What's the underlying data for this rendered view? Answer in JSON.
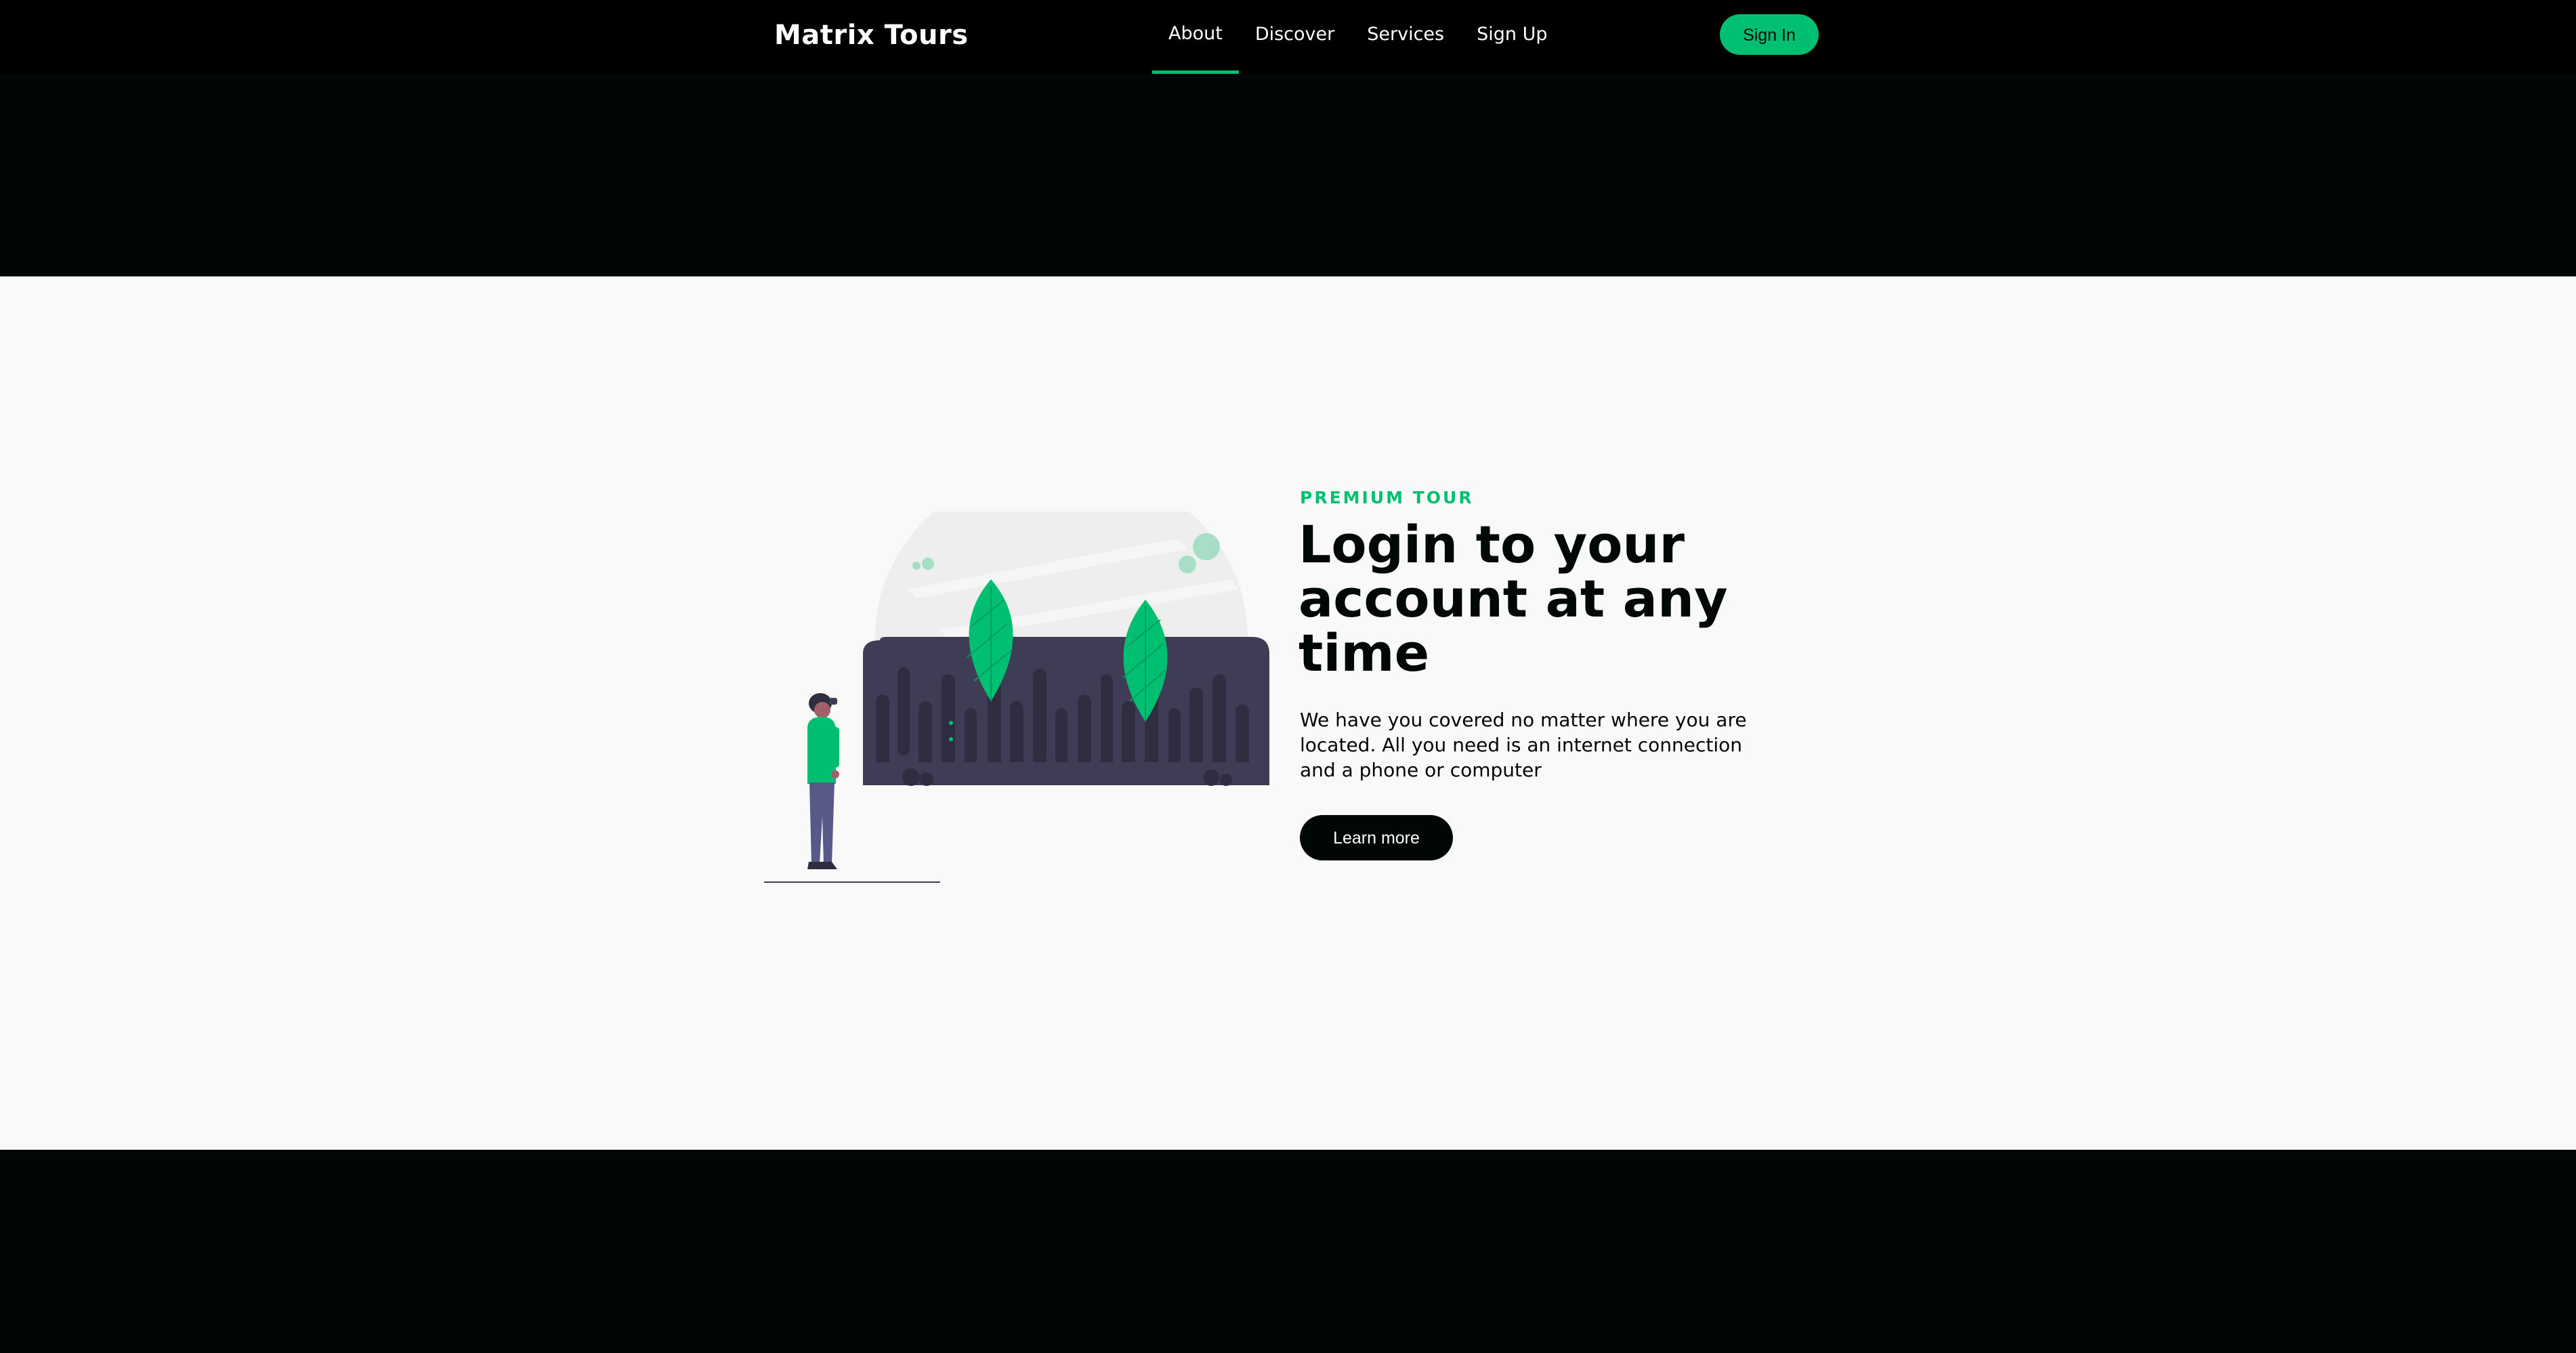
{
  "nav": {
    "logo": "Matrix Tours",
    "items": [
      {
        "label": "About",
        "active": true
      },
      {
        "label": "Discover",
        "active": false
      },
      {
        "label": "Services",
        "active": false
      },
      {
        "label": "Sign Up",
        "active": false
      }
    ],
    "signin_label": "Sign In"
  },
  "info": {
    "topline": "PREMIUM TOUR",
    "heading": "Login to your account at any time",
    "subtitle": "We have you covered no matter where you are located. All you need is an internet connection and a phone or computer",
    "button_label": "Learn more",
    "illustration_icon": "person-with-leaves-illustration"
  },
  "colors": {
    "accent": "#01bf71",
    "dark": "#010606",
    "nav_bg": "#000000",
    "light_bg": "#f9f9f9",
    "illustration_dark": "#3f3d56",
    "illustration_light_accent": "#a7dfc6"
  }
}
